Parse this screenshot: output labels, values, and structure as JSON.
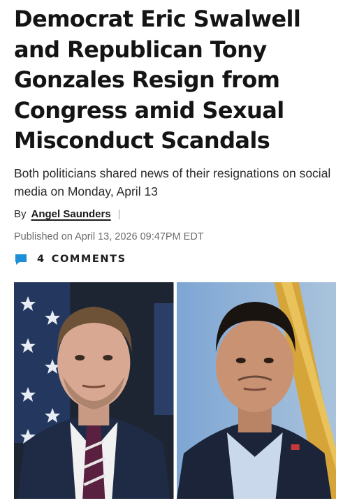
{
  "article": {
    "headline": "Democrat Eric Swalwell and Republican Tony Gonzales Resign from Congress amid Sexual Misconduct Scandals",
    "dek": "Both politicians shared news of their resignations on social media on Monday, April 13",
    "byline_prefix": "By",
    "author": "Angel Saunders",
    "published": "Published on April 13, 2026 09:47PM EDT",
    "comments_count": "4",
    "comments_label": "COMMENTS",
    "comment_icon": "comment-bubble-icon",
    "accent_color": "#1d8fd6"
  },
  "photos": [
    {
      "name": "photo-left",
      "description_icon": "portrait-photo"
    },
    {
      "name": "photo-right",
      "description_icon": "portrait-photo"
    }
  ]
}
